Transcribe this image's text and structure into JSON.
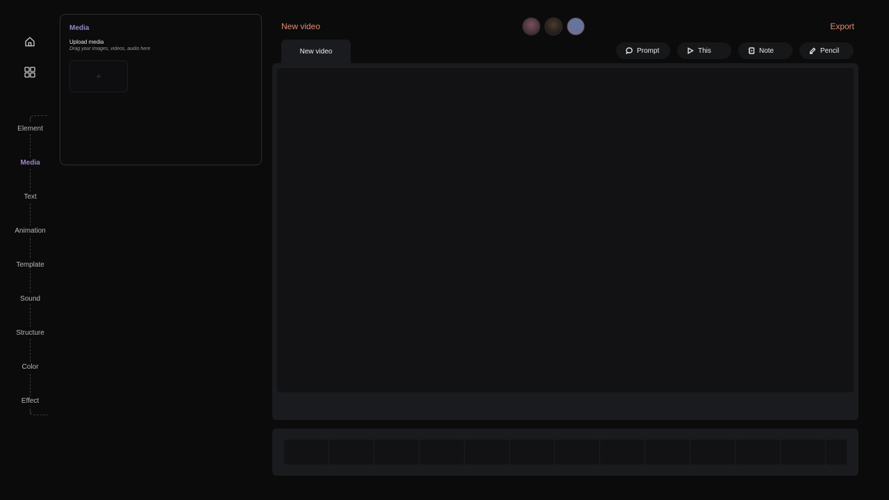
{
  "nav": {
    "items": [
      {
        "label": "Element",
        "active": false
      },
      {
        "label": "Media",
        "active": true
      },
      {
        "label": "Text",
        "active": false
      },
      {
        "label": "Animation",
        "active": false
      },
      {
        "label": "Template",
        "active": false
      },
      {
        "label": "Sound",
        "active": false
      },
      {
        "label": "Structure",
        "active": false
      },
      {
        "label": "Color",
        "active": false
      },
      {
        "label": "Effect",
        "active": false
      }
    ],
    "icons": [
      "home-icon",
      "grid-icon"
    ]
  },
  "media_panel": {
    "title": "Media",
    "upload_title": "Upload media",
    "upload_hint": "Drag your images, videos, audio here",
    "add_glyph": "+"
  },
  "header": {
    "project_name": "New video",
    "export_label": "Export",
    "avatars": [
      {
        "color_a": "#7a4f5a",
        "color_b": "#3a2a30"
      },
      {
        "color_a": "#4a3a2e",
        "color_b": "#1e1815"
      },
      {
        "color_a": "#5a7aa0",
        "color_b": "#7a6a90"
      }
    ]
  },
  "tab": {
    "label": "New video"
  },
  "tools": [
    {
      "label": "Prompt",
      "icon": "chat-bubble-icon"
    },
    {
      "label": "This",
      "icon": "play-icon"
    },
    {
      "label": "Note",
      "icon": "note-icon"
    },
    {
      "label": "Pencil",
      "icon": "pencil-icon"
    }
  ],
  "colors": {
    "accent_purple": "#9b86c8",
    "accent_orange": "#e08f70",
    "background": "#0b0b0c",
    "surface": "#1a1b1e"
  }
}
